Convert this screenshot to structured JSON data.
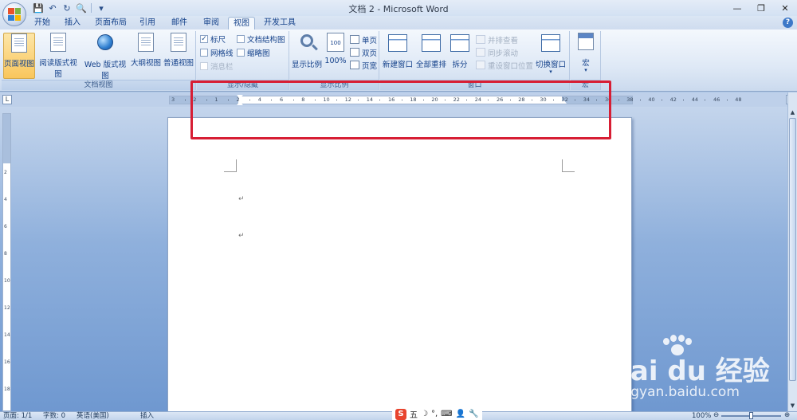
{
  "titlebar": {
    "title": "文档 2 - Microsoft Word",
    "qat": {
      "save": "💾",
      "undo": "↶",
      "redo": "↻",
      "preview": "🔍",
      "more": "▾"
    },
    "controls": {
      "minimize": "—",
      "restore": "❐",
      "close": "✕"
    }
  },
  "tabs": [
    "开始",
    "插入",
    "页面布局",
    "引用",
    "邮件",
    "审阅",
    "视图",
    "开发工具"
  ],
  "active_tab": "视图",
  "ribbon": {
    "doc_views": {
      "label": "文档视图",
      "buttons": [
        "页面视图",
        "阅读版式视图",
        "Web 版式视图",
        "大纲视图",
        "普通视图"
      ],
      "active": "页面视图"
    },
    "show_hide": {
      "label": "显示/隐藏",
      "items": [
        {
          "label": "标尺",
          "checked": true,
          "enabled": true
        },
        {
          "label": "网格线",
          "checked": false,
          "enabled": true
        },
        {
          "label": "消息栏",
          "checked": false,
          "enabled": false
        },
        {
          "label": "文档结构图",
          "checked": false,
          "enabled": true
        },
        {
          "label": "缩略图",
          "checked": false,
          "enabled": true
        }
      ],
      "check_mark": "✓"
    },
    "zoom": {
      "label": "显示比例",
      "zoom_button": "显示比例",
      "hundred_button": "100%",
      "hundred_icon_text": "100",
      "page_buttons": [
        "单页",
        "双页",
        "页宽"
      ]
    },
    "window": {
      "label": "窗口",
      "new_window": "新建窗口",
      "arrange_all": "全部重排",
      "split": "拆分",
      "small": [
        "并排查看",
        "同步滚动",
        "重设窗口位置"
      ],
      "switch_windows": "切换窗口",
      "switch_arrow": "▾"
    },
    "macros": {
      "label": "宏",
      "button": "宏",
      "arrow": "▾"
    }
  },
  "ruler": {
    "corner_symbol": "L",
    "ticks": [
      "3",
      "2",
      "1",
      "2",
      "4",
      "6",
      "8",
      "10",
      "12",
      "14",
      "16",
      "18",
      "20",
      "22",
      "24",
      "26",
      "28",
      "30",
      "32",
      "34",
      "36",
      "38",
      "40",
      "42",
      "44",
      "46",
      "48"
    ],
    "vertical_ticks": [
      "2",
      "4",
      "6",
      "8",
      "10",
      "12",
      "14",
      "16",
      "18"
    ]
  },
  "document": {
    "paragraph_mark": "↵"
  },
  "scrollbar": {
    "up": "▲",
    "down": "▼"
  },
  "statusbar": {
    "page": "页面: 1/1",
    "words": "字数: 0",
    "language": "英语(美国)",
    "mode": "插入",
    "ime": {
      "logo": "S",
      "mode": "五",
      "moon": "☽",
      "punct": "°,",
      "keyboard": "⌨",
      "user": "👤",
      "tools": "🔧"
    },
    "zoom": "100%",
    "zoom_out": "⊖",
    "zoom_in": "⊕",
    "zoom_level": 50
  },
  "watermark": {
    "main": "Bai du 经验",
    "sub": "jingyan.baidu.com"
  },
  "colors": {
    "highlight": "#d71e34",
    "accent": "#15428b"
  }
}
